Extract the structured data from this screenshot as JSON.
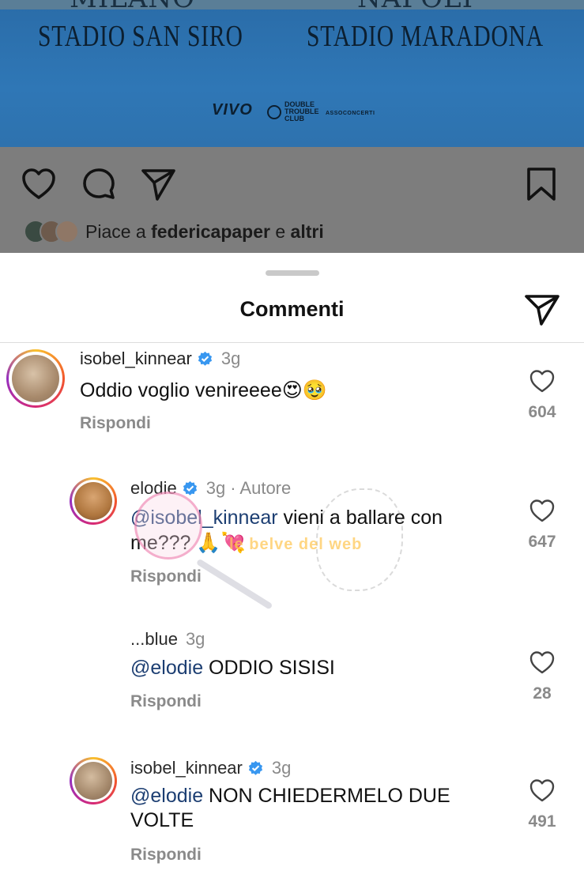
{
  "post": {
    "banner": {
      "left_cut_text": "MILANO",
      "right_cut_text": "NAPOLI",
      "left_stadium": "STADIO SAN SIRO",
      "right_stadium": "STADIO MARADONA",
      "logos": [
        "VIVO",
        "DOUBLE TROUBLE CLUB",
        "ASSOCONCERTI"
      ]
    },
    "actions": {
      "like_icon": "heart-icon",
      "comment_icon": "comment-bubble-icon",
      "share_icon": "paper-plane-icon",
      "save_icon": "bookmark-icon"
    },
    "likes": {
      "prefix": "Piace a ",
      "user": "federicapaper",
      "middle": " e ",
      "others": "altri"
    }
  },
  "sheet": {
    "title": "Commenti",
    "share_icon": "paper-plane-icon"
  },
  "comments": [
    {
      "username": "isobel_kinnear",
      "verified": true,
      "time": "3g",
      "text": "Oddio voglio venireeee",
      "emoji": "😍🥹",
      "reply_label": "Rispondi",
      "likes": "604"
    },
    {
      "username": "elodie",
      "verified": true,
      "time": "3g",
      "author_label": "· Autore",
      "mention": "@isobel_kinnear",
      "text": " vieni a ballare con me??? ",
      "emoji": "🙏💘",
      "reply_label": "Rispondi",
      "likes": "647"
    },
    {
      "username": "...blue",
      "verified": false,
      "time": "3g",
      "mention": "@elodie",
      "text": " ODDIO SISISI",
      "reply_label": "Rispondi",
      "likes": "28"
    },
    {
      "username": "isobel_kinnear",
      "verified": true,
      "time": "3g",
      "mention": "@elodie",
      "text": " NON CHIEDERMELO DUE VOLTE",
      "reply_label": "Rispondi",
      "likes": "491"
    }
  ],
  "watermark": {
    "text": "le belve del web"
  },
  "colors": {
    "banner_blue": "#2f77b6",
    "overlay_gray": "#7d7d7d",
    "mention_blue": "#1c3e72",
    "verified_blue": "#3897f0"
  }
}
